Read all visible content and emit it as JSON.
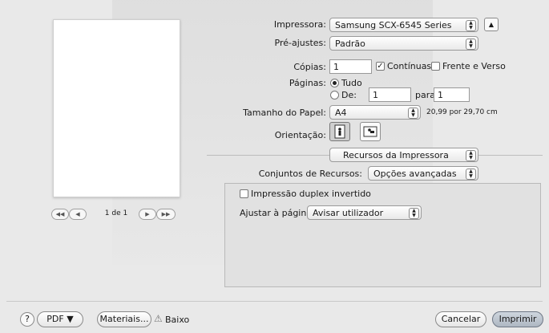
{
  "printer": {
    "label": "Impressora:",
    "value": "Samsung SCX-6545 Series"
  },
  "presets": {
    "label": "Pré-ajustes:",
    "value": "Padrão"
  },
  "copies": {
    "label": "Cópias:",
    "value": "1",
    "collated_label": "Contínuas",
    "collated_checked": true,
    "duplex_label": "Frente e Verso",
    "duplex_checked": false
  },
  "pages": {
    "label": "Páginas:",
    "all_label": "Tudo",
    "from_label": "De:",
    "from_value": "1",
    "to_label": "para:",
    "to_value": "1",
    "selected": "all"
  },
  "paper": {
    "label": "Tamanho do Papel:",
    "value": "A4",
    "dimensions": "20,99 por 29,70 cm"
  },
  "orientation": {
    "label": "Orientação:"
  },
  "section": {
    "value": "Recursos da Impressora"
  },
  "feature_sets": {
    "label": "Conjuntos de Recursos:",
    "value": "Opções avançadas"
  },
  "advanced": {
    "duplex_inverted_label": "Impressão duplex invertido",
    "duplex_inverted_checked": false,
    "fit_label": "Ajustar à página:",
    "fit_value": "Avisar utilizador"
  },
  "preview": {
    "page_indicator": "1 de 1"
  },
  "footer": {
    "help_label": "?",
    "pdf_label": "PDF ▼",
    "supplies_label": "Materiais...",
    "warning_label": "Baixo",
    "cancel_label": "Cancelar",
    "print_label": "Imprimir"
  }
}
